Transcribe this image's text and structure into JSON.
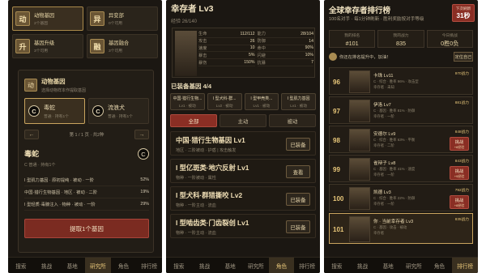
{
  "tabs": [
    "搜索",
    "挑战",
    "基地",
    "研究所",
    "角色",
    "排行榜"
  ],
  "panel1": {
    "categories": [
      {
        "icon": "动",
        "name": "动物基因",
        "sub": "2个基因"
      },
      {
        "icon": "异",
        "name": "异变部",
        "sub": "0个可用"
      },
      {
        "icon": "升",
        "name": "基因升级",
        "sub": "3个可用"
      },
      {
        "icon": "融",
        "name": "基因融合",
        "sub": "3个可用"
      }
    ],
    "box_icon": "动",
    "box_title": "动物基因",
    "box_sub": "选择动物样本作提取基因",
    "genes": [
      {
        "badge": "C",
        "name": "毒蛇",
        "sub": "普通 · 持有1个"
      },
      {
        "badge": "C",
        "name": "流浪犬",
        "sub": "普通 · 持有1个"
      }
    ],
    "prev": "←",
    "next": "→",
    "page_text": "第 1 / 1 页 · 共2种",
    "detail_name": "毒蛇",
    "detail_badge": "C",
    "detail_sub": "C 普通 · 持有1个",
    "bonuses": [
      {
        "label": "I 型肌力基因 · 原初提纯 · 被动 · 一阶",
        "value": "52%"
      },
      {
        "label": "中国·猎行生物基因 · 地区 · 被动 · 二阶",
        "value": "19%"
      },
      {
        "label": "I 型轻质·毒腺注入 · 物种 · 被动 · 一阶",
        "value": "29%"
      }
    ],
    "extract_label": "提取1个基因",
    "active_tab": 3
  },
  "panel2": {
    "title": "幸存者 Lv3",
    "exp": "经验 26/140",
    "stats": [
      {
        "label": "生命",
        "value": "112/112"
      },
      {
        "label": "能力",
        "value": "28/104"
      },
      {
        "label": "攻击",
        "value": "26"
      },
      {
        "label": "防御",
        "value": "14"
      },
      {
        "label": "速度",
        "value": "10"
      },
      {
        "label": "命中",
        "value": "90%"
      },
      {
        "label": "暴击",
        "value": "5%"
      },
      {
        "label": "闪避",
        "value": "10%"
      },
      {
        "label": "暴伤",
        "value": "150%"
      },
      {
        "label": "抗暴",
        "value": "7"
      }
    ],
    "equip_header": "已装备基因 4/4",
    "equipped": [
      {
        "name": "中国·猎行生物...",
        "lv": "Lv1 · 被动"
      },
      {
        "name": "I 型犬科·群...",
        "lv": "Lv2 · 被动"
      },
      {
        "name": "I 型甲壳类...",
        "lv": "Lv1 · 被动"
      },
      {
        "name": "I 型肌力基因",
        "lv": "Lv1 · 被动"
      }
    ],
    "filters": [
      "全部",
      "主动",
      "被动"
    ],
    "skills": [
      {
        "name": "中国·猎行生物基因 Lv1",
        "desc": "地区 · 二阶被动 · 护盾 | 攻击触发",
        "btn": "已装备"
      },
      {
        "name": "I 型亿斑类·地穴反射 Lv1",
        "desc": "物种 · 一阶被动 · 属性",
        "btn": "查看"
      },
      {
        "name": "I 型犬科·群猎撕咬 Lv2",
        "desc": "物种 · 一阶主动 · 流血",
        "btn": "已装备"
      },
      {
        "name": "I 型啮齿类·门齿裂创 Lv1",
        "desc": "物种 · 一阶主动 · 流血",
        "btn": "已装备"
      }
    ],
    "active_tab": 4
  },
  "panel3": {
    "title": "全球幸存者排行榜",
    "sub": "100名对手 · 每1分钟刷新 · 胜利奖励按对手等级",
    "timer_label": "下次刷新",
    "timer_value": "31秒",
    "summary": [
      {
        "label": "我的排名",
        "value": "#101"
      },
      {
        "label": "我的战力",
        "value": "835"
      },
      {
        "label": "今日挑战",
        "value": "0胜0负"
      }
    ],
    "notice": "你还在排名提升中，加油！",
    "notice_btn": "定位自己",
    "ranks": [
      {
        "rank": "96",
        "name": "卡珠",
        "lv": "Lv11",
        "desc": "C · 综合 · 胜率 96% · 攻击型",
        "desc2": "幸存者 · 未知",
        "power": "970战力",
        "challenge": false
      },
      {
        "rank": "97",
        "name": "伊洛",
        "lv": "Lv7",
        "desc": "C · 基因 · 胜率 81% · 防御",
        "desc2": "幸存者 · 一阶",
        "power": "881战力",
        "challenge": false
      },
      {
        "rank": "98",
        "name": "安德尔",
        "lv": "Lv9",
        "desc": "C · 综合 · 胜率 63% · 平衡",
        "desc2": "幸存者 · 二阶",
        "power": "848战力",
        "challenge": true,
        "c1": "挑战",
        "c2": "+8经验"
      },
      {
        "rank": "99",
        "name": "雀辩子",
        "lv": "Lv8",
        "desc": "C · 基因 · 胜率 41% · 速度",
        "desc2": "幸存者 · 一阶",
        "power": "843战力",
        "challenge": true,
        "c1": "挑战",
        "c2": "+9经验"
      },
      {
        "rank": "100",
        "name": "凯德",
        "lv": "Lv3",
        "desc": "C · 综合 · 胜率 22% · 防御",
        "desc2": "幸存者 · 一阶",
        "power": "792战力",
        "challenge": true,
        "c1": "挑战",
        "c2": "+8经验"
      },
      {
        "rank": "101",
        "name": "你 · 当前幸存者",
        "lv": "Lv3",
        "desc": "C · 基因 · 攻击 · 被动",
        "desc2": "幸存者",
        "power": "835战力",
        "challenge": false,
        "me": true
      }
    ],
    "active_tab": 5
  }
}
